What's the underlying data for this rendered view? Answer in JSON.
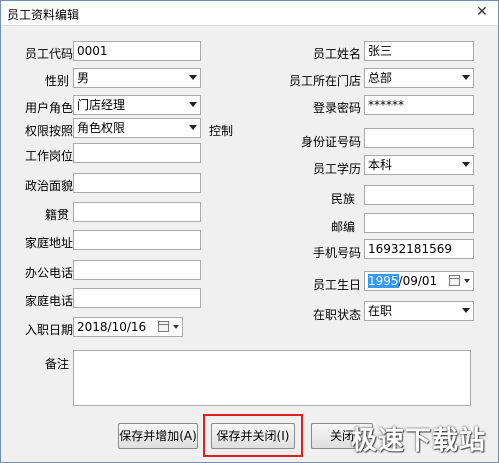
{
  "window": {
    "title": "员工资料编辑",
    "close_glyph": "✕"
  },
  "left": {
    "code_label": "员工代码",
    "code_value": "0001",
    "gender_label": "性别",
    "gender_value": "男",
    "role_label": "用户角色",
    "role_value": "门店经理",
    "perm_label": "权限按照",
    "perm_value": "角色权限",
    "perm_suffix": "控制",
    "position_label": "工作岗位",
    "position_value": "",
    "political_label": "政治面貌",
    "political_value": "",
    "native_label": "籍贯",
    "native_value": "",
    "address_label": "家庭地址",
    "address_value": "",
    "office_phone_label": "办公电话",
    "office_phone_value": "",
    "home_phone_label": "家庭电话",
    "home_phone_value": "",
    "hire_date_label": "入职日期",
    "hire_date_value": "2018/10/16"
  },
  "right": {
    "name_label": "员工姓名",
    "name_value": "张三",
    "store_label": "员工所在门店",
    "store_value": "总部",
    "password_label": "登录密码",
    "password_value": "******",
    "idcard_label": "身份证号码",
    "idcard_value": "",
    "education_label": "员工学历",
    "education_value": "本科",
    "ethnic_label": "民族",
    "ethnic_value": "",
    "postcode_label": "邮编",
    "postcode_value": "",
    "mobile_label": "手机号码",
    "mobile_value": "16932181569",
    "birthday_label": "员工生日",
    "birthday_year": "1995",
    "birthday_rest": "/09/01",
    "status_label": "在职状态",
    "status_value": "在职"
  },
  "remark": {
    "label": "备注",
    "value": ""
  },
  "buttons": {
    "save_add": "保存并增加(A)",
    "save_close": "保存并关闭(I)",
    "close": "关闭"
  },
  "watermark": "极速下载站",
  "colors": {
    "highlight": "#e02020",
    "selection": "#3399ff",
    "border": "#a9a9a9"
  }
}
